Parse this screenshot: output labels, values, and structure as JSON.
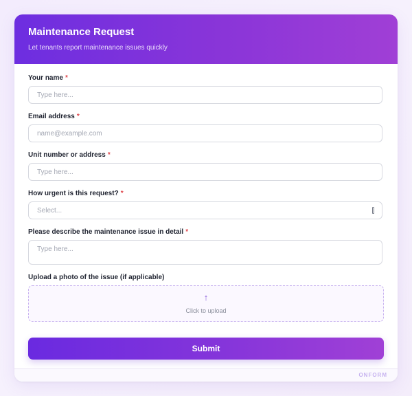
{
  "header": {
    "title": "Maintenance Request",
    "subtitle": "Let tenants report maintenance issues quickly"
  },
  "fields": [
    {
      "label": "Your name",
      "required_marker": "*",
      "placeholder": "Type here..."
    },
    {
      "label": "Email address",
      "required_marker": "*",
      "placeholder": "name@example.com"
    },
    {
      "label": "Unit number or address",
      "required_marker": "*",
      "placeholder": "Type here..."
    },
    {
      "label": "How urgent is this request?",
      "required_marker": "*",
      "placeholder": "Select..."
    },
    {
      "label": "Please describe the maintenance issue in detail",
      "required_marker": "*",
      "placeholder": "Type here..."
    }
  ],
  "upload": {
    "label": "Upload a photo of the issue (if applicable)",
    "icon": "↑",
    "text": "Click to upload"
  },
  "submit": {
    "label": "Submit"
  },
  "footer": {
    "brand": "ONFORM"
  },
  "colors": {
    "accent": "#7b2ff7",
    "accent_end": "#a040d6",
    "required": "#e0474c"
  }
}
